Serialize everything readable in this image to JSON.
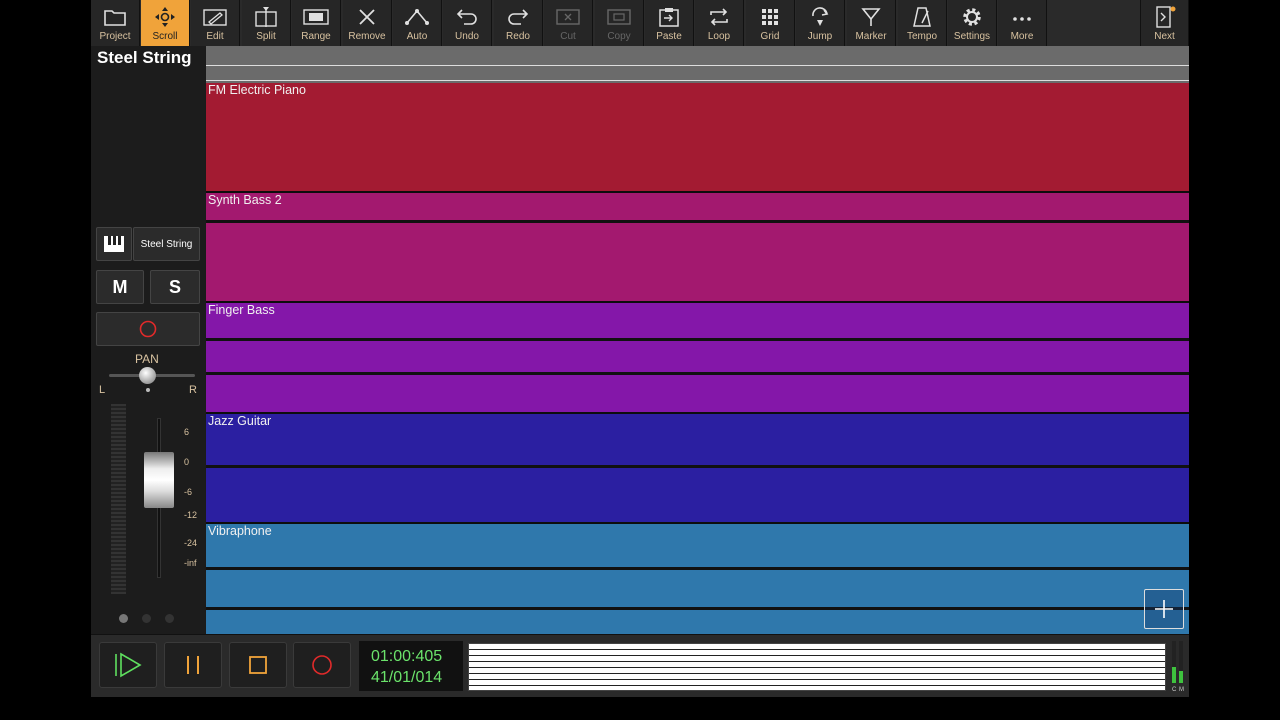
{
  "toolbar": {
    "buttons": [
      {
        "label": "Project",
        "icon": "folder-icon",
        "state": "normal"
      },
      {
        "label": "Scroll",
        "icon": "scroll-move-icon",
        "state": "active"
      },
      {
        "label": "Edit",
        "icon": "pencil-icon",
        "state": "normal"
      },
      {
        "label": "Split",
        "icon": "split-icon",
        "state": "normal"
      },
      {
        "label": "Range",
        "icon": "range-icon",
        "state": "normal"
      },
      {
        "label": "Remove",
        "icon": "close-icon",
        "state": "normal"
      },
      {
        "label": "Auto",
        "icon": "automation-icon",
        "state": "normal"
      },
      {
        "label": "Undo",
        "icon": "undo-icon",
        "state": "normal"
      },
      {
        "label": "Redo",
        "icon": "redo-icon",
        "state": "normal"
      },
      {
        "label": "Cut",
        "icon": "cut-icon",
        "state": "disabled"
      },
      {
        "label": "Copy",
        "icon": "copy-icon",
        "state": "disabled"
      },
      {
        "label": "Paste",
        "icon": "paste-icon",
        "state": "normal"
      },
      {
        "label": "Loop",
        "icon": "loop-icon",
        "state": "normal"
      },
      {
        "label": "Grid",
        "icon": "grid-icon",
        "state": "normal"
      },
      {
        "label": "Jump",
        "icon": "jump-icon",
        "state": "normal"
      },
      {
        "label": "Marker",
        "icon": "marker-icon",
        "state": "normal"
      },
      {
        "label": "Tempo",
        "icon": "metronome-icon",
        "state": "normal"
      },
      {
        "label": "Settings",
        "icon": "gear-icon",
        "state": "normal"
      },
      {
        "label": "More",
        "icon": "more-icon",
        "state": "normal"
      }
    ],
    "next_label": "Next"
  },
  "left_panel": {
    "title": "Steel String",
    "instrument_name": "Steel String",
    "mute_label": "M",
    "solo_label": "S",
    "pan_label": "PAN",
    "pan_left": "L",
    "pan_right": "R",
    "db_scale": [
      "6",
      "0",
      "-6",
      "-12",
      "-24",
      "-inf"
    ]
  },
  "tracks": [
    {
      "name": "FM Electric Piano",
      "color": "#a31b32"
    },
    {
      "name": "Synth Bass 2",
      "color": "#a3196f"
    },
    {
      "name": "Finger Bass",
      "color": "#8417a9"
    },
    {
      "name": "Jazz Guitar",
      "color": "#2b1fa1"
    },
    {
      "name": "Vibraphone",
      "color": "#2f78ac"
    }
  ],
  "transport": {
    "time_primary": "01:00:405",
    "time_secondary": "41/01/014"
  },
  "colors": {
    "accent": "#f0a33a",
    "label": "#d8c2a0",
    "time": "#6be36b"
  }
}
